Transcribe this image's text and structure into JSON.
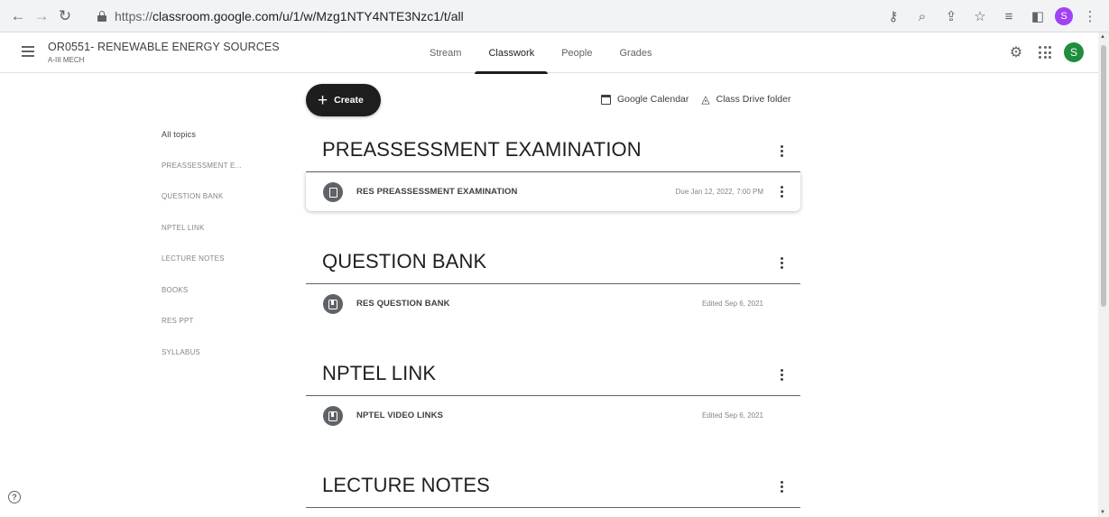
{
  "browser": {
    "url_scheme": "https://",
    "url_rest": "classroom.google.com/u/1/w/Mzg1NTY4NTE3Nzc1/t/all",
    "profile_initial": "S"
  },
  "header": {
    "class_title": "OR0551- RENEWABLE ENERGY SOURCES",
    "section": "A-III MECH",
    "tabs": [
      "Stream",
      "Classwork",
      "People",
      "Grades"
    ],
    "active_tab": "Classwork",
    "avatar_initial": "S",
    "avatar_color": "#1e8e3e"
  },
  "toolbar": {
    "create_label": "Create",
    "calendar_label": "Google Calendar",
    "drive_label": "Class Drive folder"
  },
  "topics": {
    "all": "All topics",
    "items": [
      "PREASSESSMENT E...",
      "QUESTION BANK",
      "NPTEL LINK",
      "LECTURE NOTES",
      "BOOKS",
      "RES PPT",
      "SYLLABUS"
    ]
  },
  "sections": [
    {
      "title": "PREASSESSMENT EXAMINATION",
      "items": [
        {
          "icon": "assignment-icon",
          "title": "RES PREASSESSMENT EXAMINATION",
          "meta": "Due Jan 12, 2022, 7:00 PM"
        }
      ]
    },
    {
      "title": "QUESTION BANK",
      "items": [
        {
          "icon": "material-icon",
          "title": "RES QUESTION BANK",
          "meta": "Edited Sep 6, 2021"
        }
      ]
    },
    {
      "title": "NPTEL LINK",
      "items": [
        {
          "icon": "material-icon",
          "title": "NPTEL VIDEO LINKS",
          "meta": "Edited Sep 6, 2021"
        }
      ]
    },
    {
      "title": "LECTURE NOTES",
      "items": []
    }
  ]
}
